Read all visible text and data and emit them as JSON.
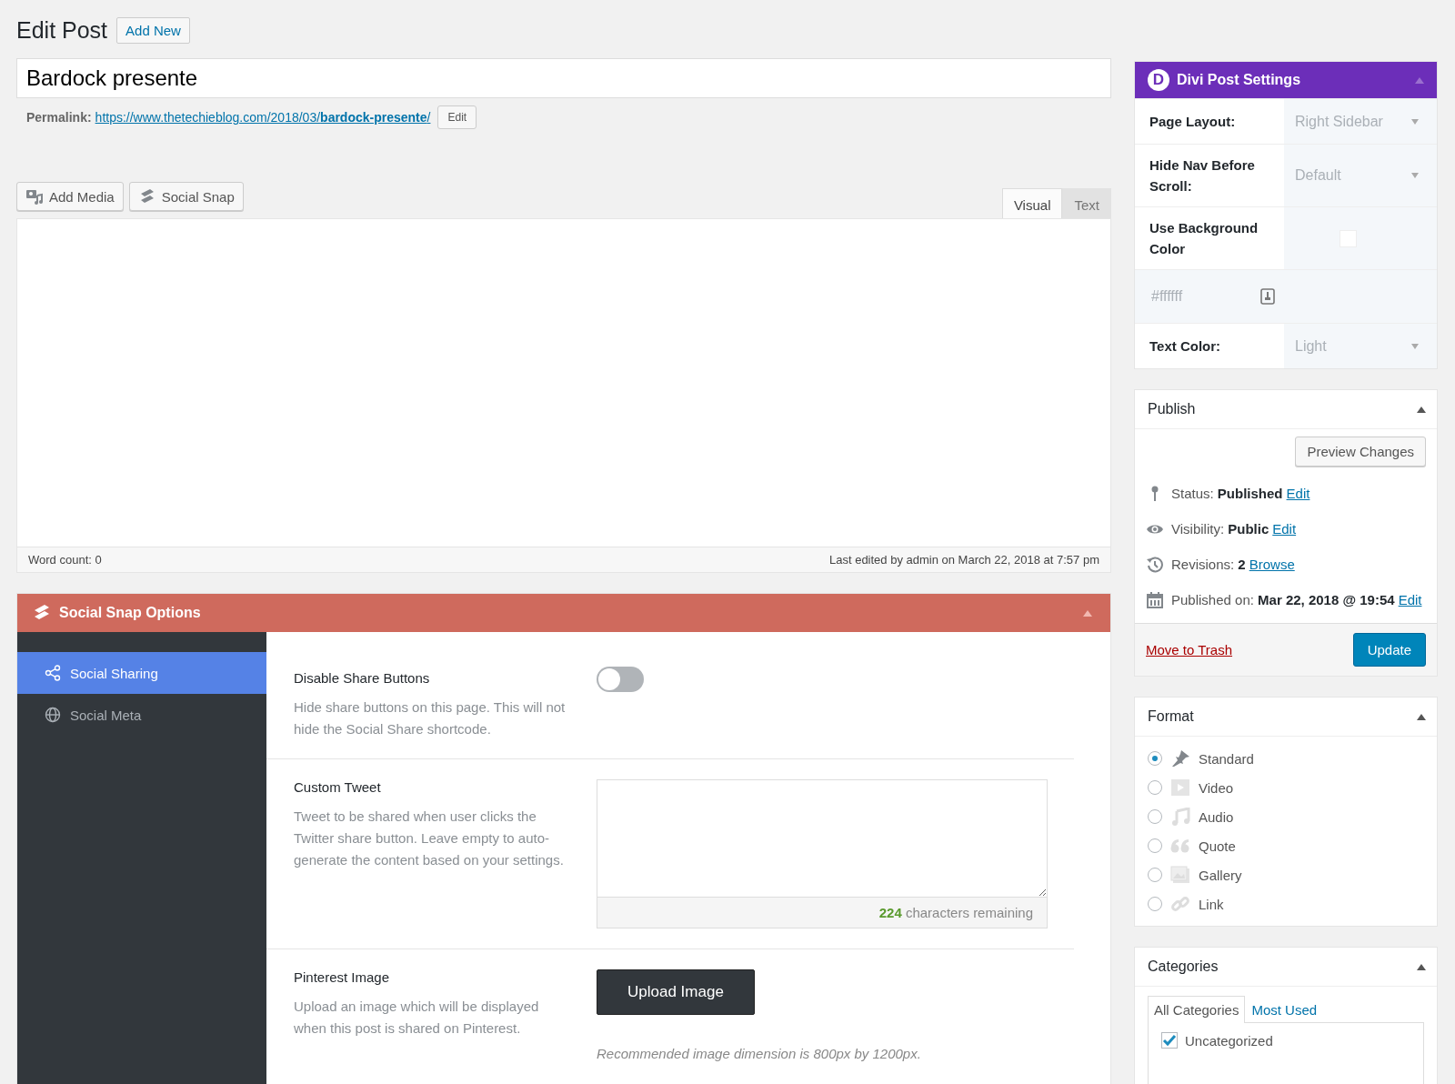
{
  "header": {
    "title": "Edit Post",
    "add_new": "Add New"
  },
  "post_title": "Bardock presente",
  "permalink": {
    "label": "Permalink:",
    "url": "https://www.thetechieblog.com/2018/03/**bardock-presente**/",
    "edit": "Edit"
  },
  "media_buttons": [
    {
      "kind": "media",
      "label": "Add Media"
    },
    {
      "kind": "snap",
      "label": "Social Snap"
    }
  ],
  "editor_tabs": [
    {
      "label": "Visual",
      "selected": true
    },
    {
      "label": "Text",
      "selected": false
    }
  ],
  "status_bar": {
    "word_count": "Word count: 0",
    "last_edited": "Last edited by admin on March 22, 2018 at 7:57 pm"
  },
  "social_snap": {
    "title": "Social Snap Options",
    "nav": [
      {
        "kind": "share",
        "label": "Social Sharing",
        "selected": true
      },
      {
        "kind": "globe",
        "label": "Social Meta",
        "selected": false
      }
    ],
    "fields": [
      {
        "kind": "toggle",
        "label": "Disable Share Buttons",
        "description": "Hide share buttons on this page. This will not hide the Social Share shortcode.",
        "on": false
      },
      {
        "kind": "textarea",
        "label": "Custom Tweet",
        "description": "Tweet to be shared when user clicks the Twitter share button. Leave empty to auto-generate the content based on your settings.",
        "count": "224",
        "count_text": "characters remaining"
      },
      {
        "kind": "upload",
        "label": "Pinterest Image",
        "description": "Upload an image which will be displayed when this post is shared on Pinterest.",
        "button": "Upload Image",
        "note": "Recommended image dimension is 800px by 1200px."
      }
    ]
  },
  "divi": {
    "title": "Divi Post Settings",
    "logo": "D",
    "rows": [
      {
        "kind": "select",
        "label": "Page Layout:",
        "value": "Right Sidebar"
      },
      {
        "kind": "select",
        "label": "Hide Nav Before Scroll:",
        "value": "Default"
      },
      {
        "kind": "checkbox",
        "label": "Use Background Color",
        "checked": false
      },
      {
        "kind": "color",
        "value": "#ffffff"
      },
      {
        "kind": "select",
        "label": "Text Color:",
        "value": "Light"
      }
    ]
  },
  "publish": {
    "title": "Publish",
    "preview": "Preview Changes",
    "items": [
      {
        "kind": "status",
        "label": "Status:",
        "value": "Published",
        "link": "Edit"
      },
      {
        "kind": "visibility",
        "label": "Visibility:",
        "value": "Public",
        "link": "Edit"
      },
      {
        "kind": "revisions",
        "label": "Revisions:",
        "value": "2",
        "link": "Browse"
      },
      {
        "kind": "date",
        "label": "Published on:",
        "value": "Mar 22, 2018 @ 19:54",
        "link": "Edit"
      }
    ],
    "trash": "Move to Trash",
    "update": "Update"
  },
  "format": {
    "title": "Format",
    "options": [
      {
        "kind": "standard",
        "label": "Standard",
        "selected": true
      },
      {
        "kind": "video",
        "label": "Video",
        "selected": false
      },
      {
        "kind": "audio",
        "label": "Audio",
        "selected": false
      },
      {
        "kind": "quote",
        "label": "Quote",
        "selected": false
      },
      {
        "kind": "gallery",
        "label": "Gallery",
        "selected": false
      },
      {
        "kind": "link",
        "label": "Link",
        "selected": false
      }
    ]
  },
  "categories": {
    "title": "Categories",
    "tabs": [
      {
        "label": "All Categories",
        "selected": true
      },
      {
        "label": "Most Used",
        "selected": false
      }
    ],
    "items": [
      {
        "label": "Uncategorized",
        "checked": true
      }
    ]
  }
}
